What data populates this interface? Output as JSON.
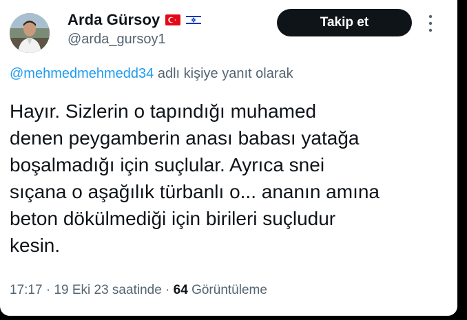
{
  "author": {
    "display_name": "Arda Gürsoy",
    "handle": "@arda_gursoy1",
    "flags": [
      "turkey-flag",
      "israel-flag"
    ]
  },
  "actions": {
    "follow_label": "Takip et",
    "more_icon": "more-dots-vertical-icon"
  },
  "reply": {
    "mention": "@mehmedmehmedd34",
    "suffix": " adlı kişiye yanıt olarak"
  },
  "tweet": {
    "lines": [
      "Hayır. Sizlerin o tapındığı muhamed",
      "denen peygamberin anası babası yatağa",
      "boşalmadığı için suçlular. Ayrıca snei",
      "sıçana o aşağılık türbanlı o... ananın amına",
      "beton dökülmediği için birileri suçludur",
      "kesin."
    ]
  },
  "meta": {
    "time": "17:17",
    "separator": " · ",
    "date": "19 Eki 23 saatinde",
    "views_count": "64",
    "views_label": " Görüntüleme"
  },
  "colors": {
    "text_primary": "#0f1419",
    "text_secondary": "#536471",
    "link": "#1d9bf0",
    "button_bg": "#0f1419"
  }
}
